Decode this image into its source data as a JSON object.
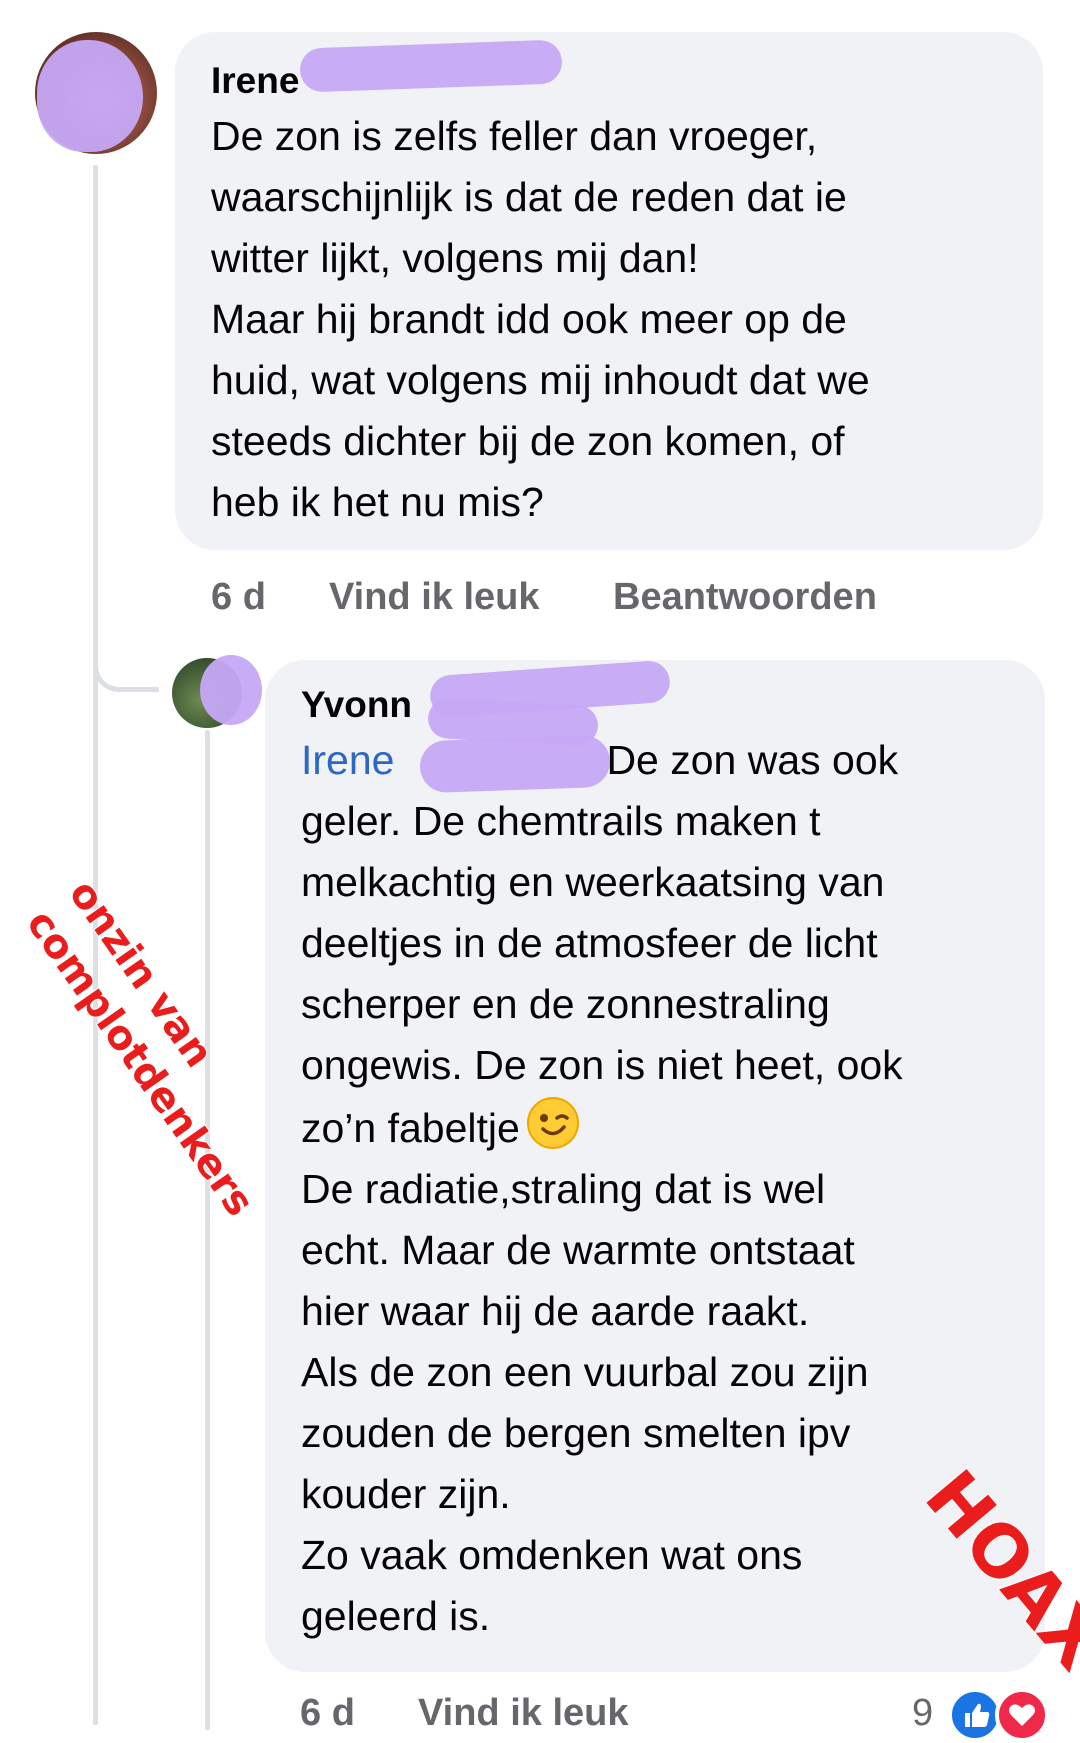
{
  "comments": [
    {
      "author_visible": "Irene",
      "text_lines": [
        "De zon is zelfs feller dan vroeger,",
        "waarschijnlijk is dat de reden dat ie",
        "witter lijkt, volgens mij dan!",
        "Maar hij brandt idd ook meer op de",
        "huid, wat volgens mij inhoudt dat we",
        "steeds dichter bij de zon komen, of",
        "heb ik het nu mis?"
      ],
      "actions": {
        "time": "6 d",
        "like": "Vind ik leuk",
        "reply": "Beantwoorden"
      }
    }
  ],
  "reply": {
    "author_visible": "Yvonn",
    "mention": "Irene",
    "first_line_rest": "De zon was ook",
    "text_lines": [
      "geler. De chemtrails maken t",
      "melkachtig en weerkaatsing van",
      "deeltjes in de atmosfeer de licht",
      "scherper en de zonnestraling",
      "ongewis. De zon is niet heet, ook"
    ],
    "emoji_line_text": "zo’n fabeltje",
    "emoji": "winking-face",
    "text_lines_after": [
      "De radiatie,straling dat is wel",
      "echt. Maar de warmte ontstaat",
      "hier waar hij de aarde raakt.",
      "Als de zon een vuurbal zou zijn",
      "zouden de bergen smelten ipv",
      "kouder zijn.",
      "Zo vaak omdenken wat ons",
      "geleerd is."
    ],
    "actions": {
      "time": "6 d",
      "like": "Vind ik leuk"
    },
    "reaction_count": "9",
    "reactions": [
      "like-icon",
      "love-icon"
    ]
  },
  "overlays": {
    "annotation_line1": "onzin van",
    "annotation_line2": "complotdenkers",
    "stamp": "HOAX",
    "color": "#ea1c1c",
    "censor_color": "#c6a8f5"
  }
}
